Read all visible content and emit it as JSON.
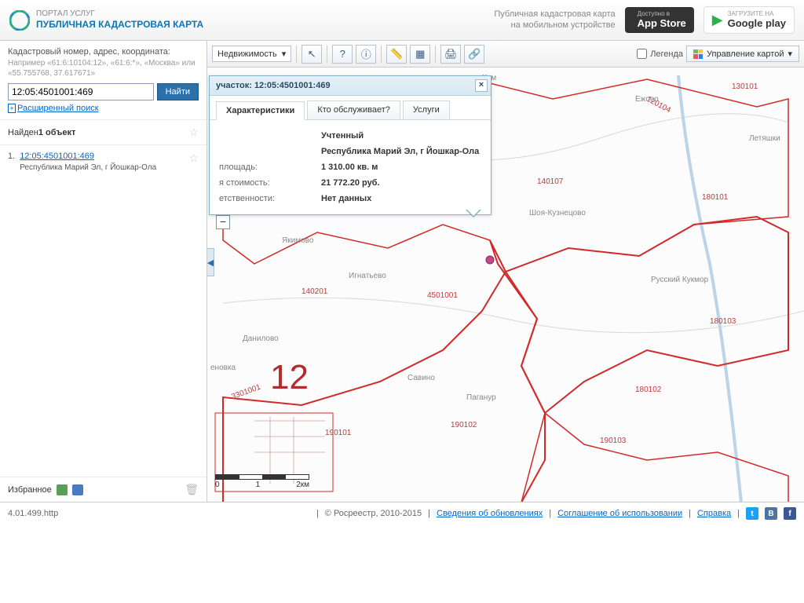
{
  "header": {
    "portal": "ПОРТАЛ УСЛУГ",
    "app": "ПУБЛИЧНАЯ КАДАСТРОВАЯ КАРТА",
    "tagline1": "Публичная кадастровая карта",
    "tagline2": "на мобильном устройстве",
    "appstore_sub": "Доступно в",
    "appstore_main": "App Store",
    "gplay_sub": "ЗАГРУЗИТЕ НА",
    "gplay_main": "Google play"
  },
  "search": {
    "label": "Кадастровый номер, адрес, координата:",
    "hint": "Например «61:6:10104:12», «61:6:*», «Москва» или «55.755768, 37.617671»",
    "value": "12:05:4501001:469",
    "button": "Найти",
    "advanced": "Расширенный поиск"
  },
  "results": {
    "header_prefix": "Найден ",
    "header_bold": "1 объект",
    "items": [
      {
        "idx": "1.",
        "cad": "12:05:4501001:469",
        "addr": "Республика Марий Эл, г Йошкар-Ола"
      }
    ]
  },
  "favorites": {
    "label": "Избранное"
  },
  "toolbar": {
    "layer": "Недвижимость",
    "legend": "Легенда",
    "manage": "Управление картой"
  },
  "popup": {
    "title_prefix": "участок: ",
    "title_id": "12:05:4501001:469",
    "tabs": [
      "Характеристики",
      "Кто обслуживает?",
      "Услуги"
    ],
    "rows": [
      {
        "k": "",
        "v": "Учтенный"
      },
      {
        "k": "",
        "v": "Республика Марий Эл, г Йошкар-Ола"
      },
      {
        "k": "площадь:",
        "v": "1 310.00 кв. м"
      },
      {
        "k": "я стоимость:",
        "v": "21 772.20 руб."
      },
      {
        "k": "етственности:",
        "v": "Нет данных"
      }
    ]
  },
  "map": {
    "bignum": "12",
    "cad_labels": [
      "140201",
      "4501001",
      "140107",
      "180101",
      "180103",
      "130101",
      "190102",
      "190101",
      "190103",
      "120104",
      "3301001",
      "180102"
    ],
    "places": [
      "Ким",
      "Ежово",
      "Летяшки",
      "Шоя-Кузнецово",
      "Русский Кукмор",
      "Игнатьево",
      "Якимово",
      "Данилово",
      "Савино",
      "Паганур",
      "еновка"
    ],
    "scale": [
      "0",
      "1",
      "2км"
    ]
  },
  "footer": {
    "version": "4.01.499.http",
    "copyright": "© Росреестр, 2010-2015",
    "links": [
      "Сведения об обновлениях",
      "Соглашение об использовании",
      "Справка"
    ]
  }
}
